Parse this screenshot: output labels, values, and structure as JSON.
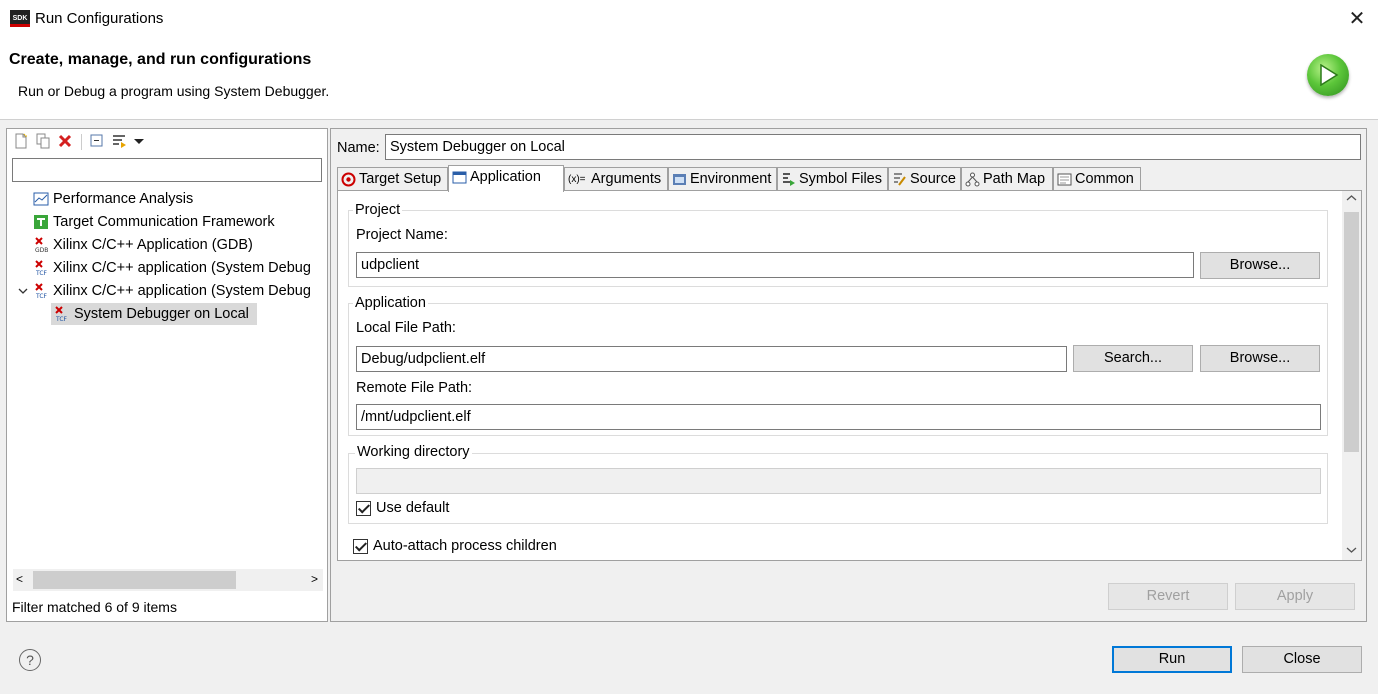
{
  "window": {
    "title": "Run Configurations",
    "app_icon_text": "SDK"
  },
  "banner": {
    "title": "Create, manage, and run configurations",
    "subtitle": "Run or Debug a program using System Debugger."
  },
  "left": {
    "filter_value": "",
    "tree": [
      {
        "label": "Performance Analysis",
        "icon": "performance-icon"
      },
      {
        "label": "Target Communication Framework",
        "icon": "tcf-icon"
      },
      {
        "label": "Xilinx C/C++ Application (GDB)",
        "icon": "xilinx-gdb-icon"
      },
      {
        "label": "Xilinx C/C++ application (System Debug",
        "icon": "xilinx-tcf-icon"
      },
      {
        "label": "Xilinx C/C++ application (System Debug",
        "icon": "xilinx-tcf-icon",
        "expanded": true
      },
      {
        "label": "System Debugger on Local",
        "icon": "xilinx-tcf-icon",
        "selected": true
      }
    ],
    "status": "Filter matched 6 of 9 items"
  },
  "right": {
    "name_label": "Name:",
    "name_value": "System Debugger on Local",
    "tabs": [
      {
        "label": "Target Setup",
        "icon": "target-icon"
      },
      {
        "label": "Application",
        "icon": "application-icon",
        "active": true
      },
      {
        "label": "Arguments",
        "icon": "arguments-icon"
      },
      {
        "label": "Environment",
        "icon": "environment-icon"
      },
      {
        "label": "Symbol Files",
        "icon": "symbol-files-icon"
      },
      {
        "label": "Source",
        "icon": "source-icon"
      },
      {
        "label": "Path Map",
        "icon": "path-map-icon"
      },
      {
        "label": "Common",
        "icon": "common-icon"
      }
    ],
    "project": {
      "group_title": "Project",
      "name_label": "Project Name:",
      "name_value": "udpclient",
      "browse_label": "Browse..."
    },
    "application": {
      "group_title": "Application",
      "local_label": "Local File Path:",
      "local_value": "Debug/udpclient.elf",
      "search_label": "Search...",
      "browse_label": "Browse...",
      "remote_label": "Remote File Path:",
      "remote_value": "/mnt/udpclient.elf"
    },
    "working_dir": {
      "group_title": "Working directory",
      "value": "",
      "use_default_label": "Use default",
      "use_default_checked": true
    },
    "auto_attach_label": "Auto-attach process children",
    "auto_attach_checked": true,
    "revert_label": "Revert",
    "apply_label": "Apply"
  },
  "footer": {
    "help_glyph": "?",
    "run_label": "Run",
    "close_label": "Close"
  }
}
